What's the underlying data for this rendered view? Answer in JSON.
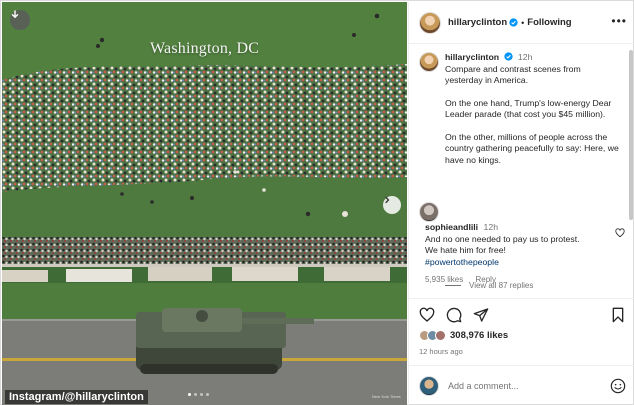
{
  "photo": {
    "caption": "Washington, DC",
    "credit_small": "New York Times",
    "watermark": "Instagram/@hillaryclinton",
    "carousel_dots": 4,
    "carousel_active": 0
  },
  "header": {
    "username": "hillaryclinton",
    "separator": "•",
    "follow_status": "Following",
    "more": "•••"
  },
  "post": {
    "username": "hillaryclinton",
    "time": "12h",
    "paragraphs": [
      "Compare and contrast scenes from yesterday in America.",
      "On the one hand, Trump's low-energy Dear Leader parade (that cost you $45 million).",
      "On the other, millions of people across the country gathering peacefully to say: Here, we have no kings."
    ]
  },
  "comment": {
    "username": "sophieandlili",
    "time": "12h",
    "text": "And no one needed to pay us to protest. We hate him for free!",
    "hashtag": "#powertothepeople",
    "likes": "5,935 likes",
    "reply": "Reply",
    "view_replies": "View all 87 replies"
  },
  "stats": {
    "likes": "308,976 likes",
    "posted": "12 hours ago"
  },
  "add_comment": {
    "placeholder": "Add a comment..."
  },
  "colors": {
    "verified": "#0095f6",
    "muted": "#737373",
    "hashtag": "#00376b",
    "border": "#dbdbdb"
  },
  "icons": [
    "download-icon",
    "chevron-right-icon",
    "more-icon",
    "verified-icon",
    "heart-icon",
    "comment-icon",
    "share-icon",
    "bookmark-icon",
    "emoji-icon"
  ]
}
